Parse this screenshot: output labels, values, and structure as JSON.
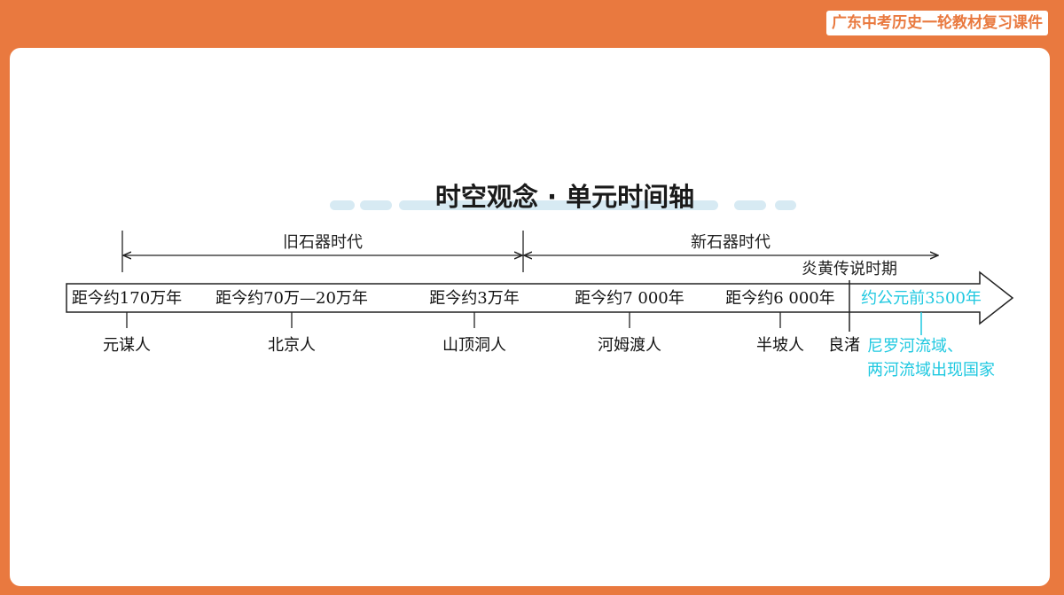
{
  "header": {
    "badge": "广东中考历史一轮教材复习课件"
  },
  "diagram": {
    "title": "时空观念 · 单元时间轴",
    "periods": [
      {
        "label": "旧石器时代"
      },
      {
        "label": "新石器时代"
      },
      {
        "label": "炎黄传说时期"
      }
    ],
    "ticks": [
      {
        "time": "距今约170万年",
        "site": "元谋人"
      },
      {
        "time": "距今约70万—20万年",
        "site": "北京人"
      },
      {
        "time": "距今约3万年",
        "site": "山顶洞人"
      },
      {
        "time": "距今约7 000年",
        "site": "河姆渡人"
      },
      {
        "time": "距今约6 000年",
        "site": "半坡人"
      },
      {
        "time": "",
        "site": "良渚"
      }
    ],
    "highlight": {
      "time": "约公元前3500年",
      "event_line1": "尼罗河流域、",
      "event_line2": "两河流域出现国家"
    },
    "colors": {
      "accent": "#e9793f",
      "highlight": "#1ec8e0",
      "line": "#222222",
      "deco": "#d7eaf3"
    }
  }
}
